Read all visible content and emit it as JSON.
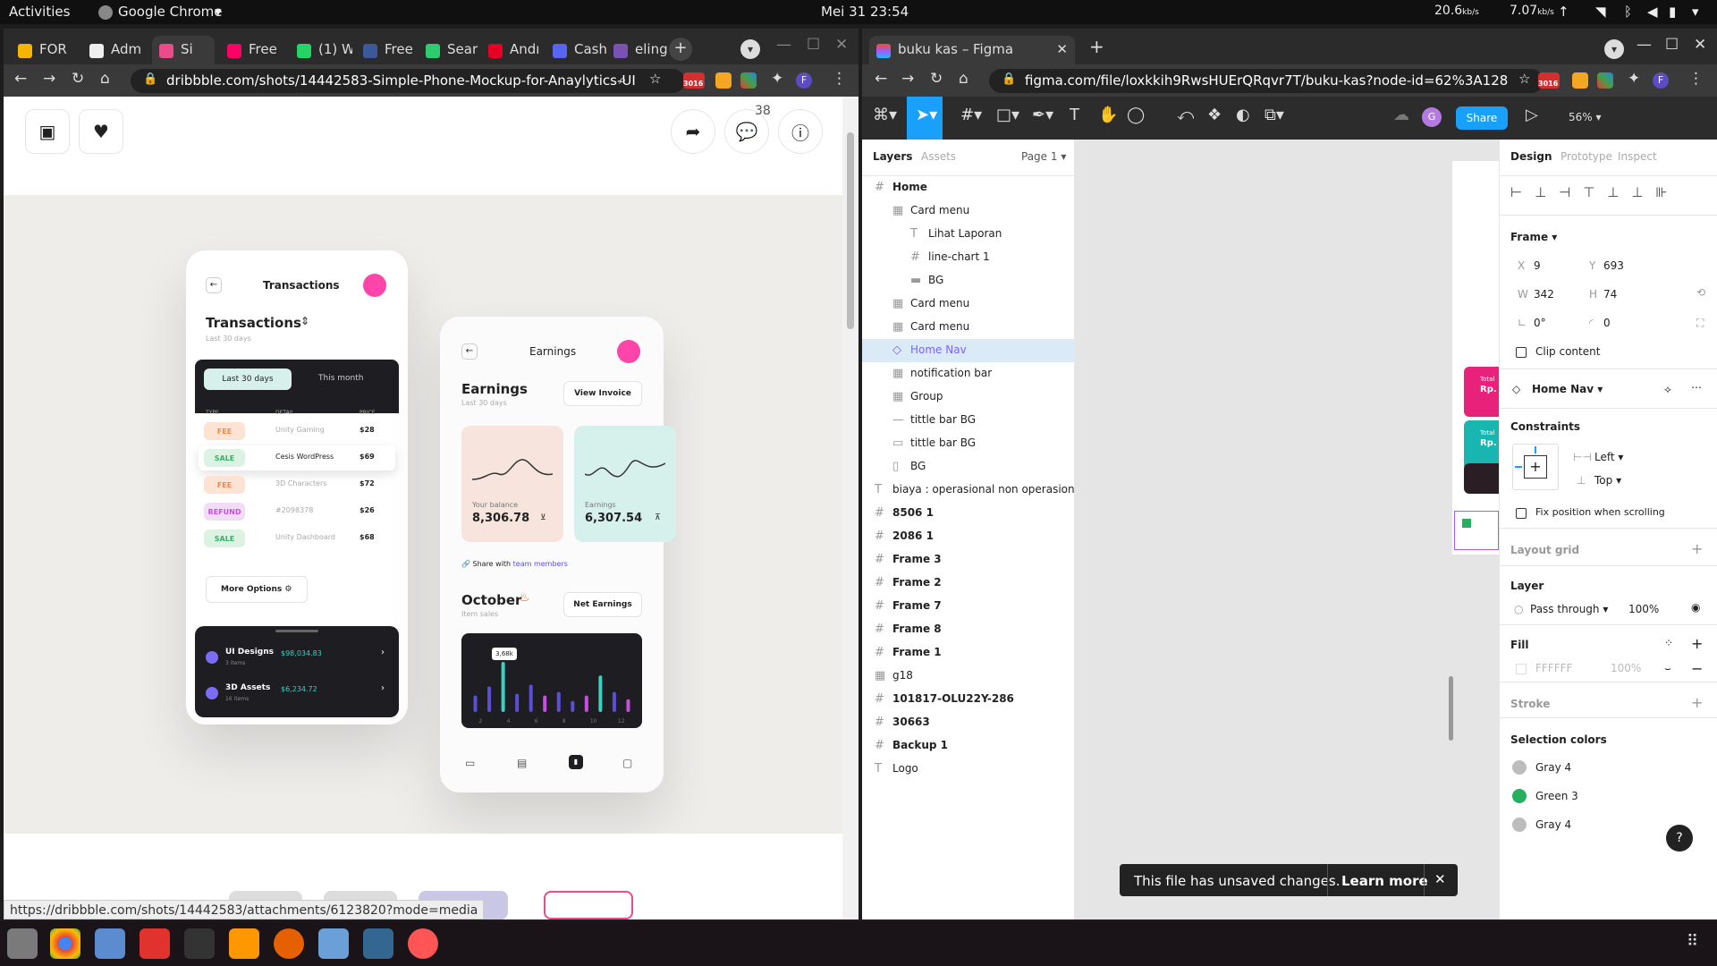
{
  "topbar": {
    "activities": "Activities",
    "app": "Google Chrome",
    "clock": "Mei 31  23:54",
    "net_down": "20.6",
    "net_down_unit": "kb/s",
    "net_up": "7.07",
    "net_up_unit": "kb/s"
  },
  "chrome1": {
    "tabs": [
      {
        "label": "FOR",
        "color": "#f4b400"
      },
      {
        "label": "Adm",
        "color": "#eee"
      },
      {
        "label": "Si",
        "color": "#ea4c89"
      },
      {
        "label": "Free",
        "color": "#f06"
      },
      {
        "label": "(1) W",
        "color": "#25d366"
      },
      {
        "label": "Free",
        "color": "#3b5998"
      },
      {
        "label": "Sear",
        "color": "#2ecc71"
      },
      {
        "label": "Andı",
        "color": "#e60023"
      },
      {
        "label": "Cash",
        "color": "#5865f2"
      },
      {
        "label": "eling",
        "color": "#7952b3"
      }
    ],
    "url": "dribbble.com/shots/14442583-Simple-Phone-Mockup-for-Anaylytics-UI",
    "badge": "3016",
    "comments_count": "38",
    "status_url": "https://dribbble.com/shots/14442583/attachments/6123820?mode=media"
  },
  "shot": {
    "p1": {
      "title": "Transactions",
      "heading": "Transactions",
      "sub": "Last 30 days",
      "tab_a": "Last 30 days",
      "tab_b": "This month",
      "col_type": "TYPE",
      "col_detail": "DETAIL",
      "col_price": "PRICE",
      "rows": [
        {
          "type": "FEE",
          "detail": "Unity Gaming",
          "price": "$28",
          "bg": "#fde3d3",
          "fg": "#f2884b"
        },
        {
          "type": "SALE",
          "detail": "Cesis WordPress",
          "price": "$69",
          "bg": "#dcf3e4",
          "fg": "#33b366"
        },
        {
          "type": "FEE",
          "detail": "3D Characters",
          "price": "$72",
          "bg": "#fde3d3",
          "fg": "#f2884b"
        },
        {
          "type": "REFUND",
          "detail": "#2098378",
          "price": "$26",
          "bg": "#f3dcf7",
          "fg": "#c64ee0"
        },
        {
          "type": "SALE",
          "detail": "Unity Dashboard",
          "price": "$68",
          "bg": "#dcf3e4",
          "fg": "#33b366"
        }
      ],
      "more": "More Options",
      "bottom": [
        {
          "name": "UI Designs",
          "items": "3 items",
          "amount": "$98,034.83"
        },
        {
          "name": "3D Assets",
          "items": "16 items",
          "amount": "$6,234.72"
        }
      ]
    },
    "p2": {
      "title": "Earnings",
      "heading": "Earnings",
      "sub": "Last 30 days",
      "view_invoice": "View Invoice",
      "card1_label": "Your balance",
      "card1_value": "8,306.78",
      "card2_label": "Earnings",
      "card2_value": "6,307.54",
      "share_prefix": "Share with ",
      "share_link": "team members",
      "october": "October",
      "october_sub": "Item sales",
      "net_earnings": "Net Earnings",
      "tooltip": "3,68k",
      "chart_data": {
        "type": "bar",
        "x_ticks": [
          "2",
          "4",
          "6",
          "8",
          "10",
          "12"
        ],
        "values": [
          18,
          28,
          55,
          20,
          30,
          18,
          22,
          12,
          18,
          40,
          22,
          14
        ],
        "highlight": [
          2,
          9
        ]
      }
    }
  },
  "figma": {
    "tab": "buku kas – Figma",
    "url": "figma.com/file/loxkkih9RwsHUErQRqvr7T/buku-kas?node-id=62%3A128",
    "badge": "3016",
    "share": "Share",
    "zoom": "56%",
    "avatar": "G",
    "panel_tabs": {
      "layers": "Layers",
      "assets": "Assets",
      "page": "Page 1"
    },
    "layers": [
      {
        "name": "Home",
        "indent": 0,
        "icon": "#",
        "bold": true
      },
      {
        "name": "Card menu",
        "indent": 1,
        "icon": "▦"
      },
      {
        "name": "Lihat Laporan",
        "indent": 2,
        "icon": "T"
      },
      {
        "name": "line-chart 1",
        "indent": 2,
        "icon": "#"
      },
      {
        "name": "BG",
        "indent": 2,
        "icon": "▬"
      },
      {
        "name": "Card menu",
        "indent": 1,
        "icon": "▦"
      },
      {
        "name": "Card menu",
        "indent": 1,
        "icon": "▦"
      },
      {
        "name": "Home Nav",
        "indent": 1,
        "icon": "◇",
        "selected": true
      },
      {
        "name": "notification bar",
        "indent": 1,
        "icon": "▦"
      },
      {
        "name": "Group",
        "indent": 1,
        "icon": "▦"
      },
      {
        "name": "tittle bar BG",
        "indent": 1,
        "icon": "—"
      },
      {
        "name": "tittle bar BG",
        "indent": 1,
        "icon": "▭"
      },
      {
        "name": "BG",
        "indent": 1,
        "icon": "▯"
      },
      {
        "name": "biaya : operasional non operasional",
        "indent": 0,
        "icon": "T"
      },
      {
        "name": "8506 1",
        "indent": 0,
        "icon": "#",
        "bold": true
      },
      {
        "name": "2086 1",
        "indent": 0,
        "icon": "#",
        "bold": true
      },
      {
        "name": "Frame 3",
        "indent": 0,
        "icon": "#",
        "bold": true
      },
      {
        "name": "Frame 2",
        "indent": 0,
        "icon": "#",
        "bold": true
      },
      {
        "name": "Frame 7",
        "indent": 0,
        "icon": "#",
        "bold": true
      },
      {
        "name": "Frame 8",
        "indent": 0,
        "icon": "#",
        "bold": true
      },
      {
        "name": "Frame 1",
        "indent": 0,
        "icon": "#",
        "bold": true
      },
      {
        "name": "g18",
        "indent": 0,
        "icon": "▦"
      },
      {
        "name": "101817-OLU22Y-286",
        "indent": 0,
        "icon": "#",
        "bold": true
      },
      {
        "name": "30663",
        "indent": 0,
        "icon": "#",
        "bold": true
      },
      {
        "name": "Backup 1",
        "indent": 0,
        "icon": "#",
        "bold": true
      },
      {
        "name": "Logo",
        "indent": 0,
        "icon": "T"
      }
    ],
    "design": {
      "tabs": [
        "Design",
        "Prototype",
        "Inspect"
      ],
      "frame": "Frame",
      "x_label": "X",
      "x": "9",
      "y_label": "Y",
      "y": "693",
      "w_label": "W",
      "w": "342",
      "h_label": "H",
      "h": "74",
      "rot": "0°",
      "radius": "0",
      "clip": "Clip content",
      "component": "Home Nav",
      "constraints": "Constraints",
      "c_h": "Left",
      "c_v": "Top",
      "fix": "Fix position when scrolling",
      "layout_grid": "Layout grid",
      "layer": "Layer",
      "blend": "Pass through",
      "opacity": "100%",
      "fill": "Fill",
      "fill_hex": "FFFFFF",
      "fill_op": "100%",
      "stroke": "Stroke",
      "sel_colors": "Selection colors",
      "colors": [
        {
          "name": "Gray 4",
          "hex": "#bdbdbd"
        },
        {
          "name": "Green 3",
          "hex": "#27ae60"
        },
        {
          "name": "Gray 4",
          "hex": "#bdbdbd"
        }
      ]
    },
    "toast": {
      "msg": "This file has unsaved changes.",
      "action": "Learn more"
    },
    "canvas_cards": [
      {
        "label": "Total",
        "value": "Rp.",
        "color": "#e8217a"
      },
      {
        "label": "Total",
        "value": "Rp.",
        "color": "#19b5b0"
      }
    ]
  }
}
